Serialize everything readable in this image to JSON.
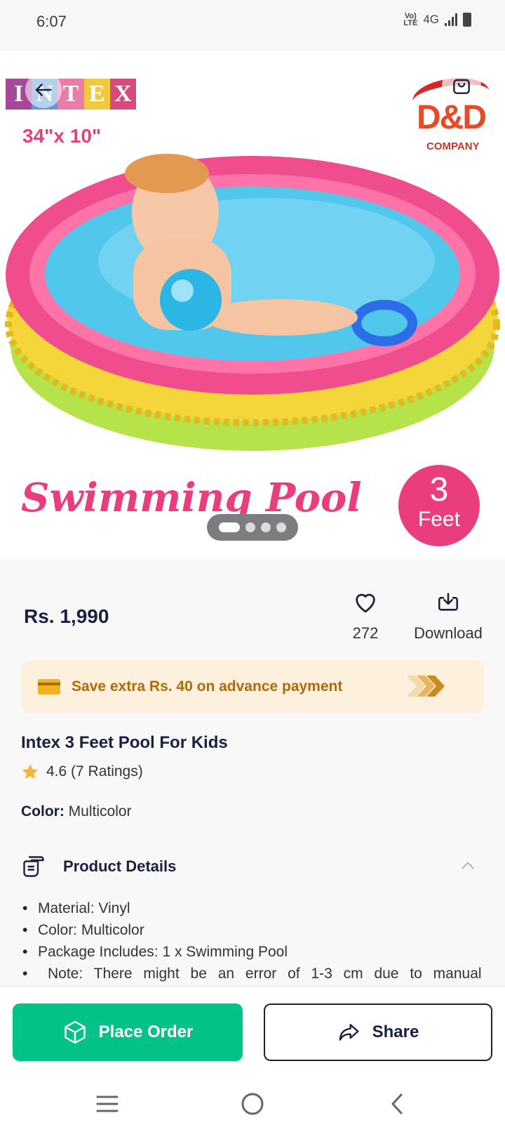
{
  "status_bar": {
    "time": "6:07",
    "network": "4G",
    "volte": "VoLTE"
  },
  "product_image": {
    "brand_letters": [
      "I",
      "N",
      "T",
      "E",
      "X"
    ],
    "brand_colors": [
      "#a6479a",
      "#5d9ad6",
      "#e87ea8",
      "#f0c93c",
      "#d64b7a"
    ],
    "size_text": "34\"x 10\"",
    "company_logo": "D&D",
    "company_label": "COMPANY",
    "caption": "Swimming Pool",
    "badge_number": "3",
    "badge_unit": "Feet",
    "carousel_total": 4,
    "carousel_active": 1
  },
  "price": "Rs. 1,990",
  "actions": {
    "like_count": "272",
    "download_label": "Download"
  },
  "offer": {
    "text": "Save extra Rs. 40 on advance payment"
  },
  "product": {
    "title": "Intex 3 Feet Pool For Kids",
    "rating": "4.6 (7 Ratings)",
    "color_key": "Color:",
    "color_value": "Multicolor"
  },
  "product_details": {
    "heading": "Product Details",
    "items": [
      "Material: Vinyl",
      "Color: Multicolor",
      "Package Includes: 1 x Swimming Pool",
      "Note: There might be an error of 1-3 cm due to manual"
    ]
  },
  "bottom_bar": {
    "place_order_label": "Place Order",
    "share_label": "Share"
  },
  "colors": {
    "primary_green": "#03c287",
    "navy": "#1a2140",
    "offer_bg": "#fdf0dd",
    "offer_text": "#b06a08",
    "pink": "#e93d7d"
  }
}
